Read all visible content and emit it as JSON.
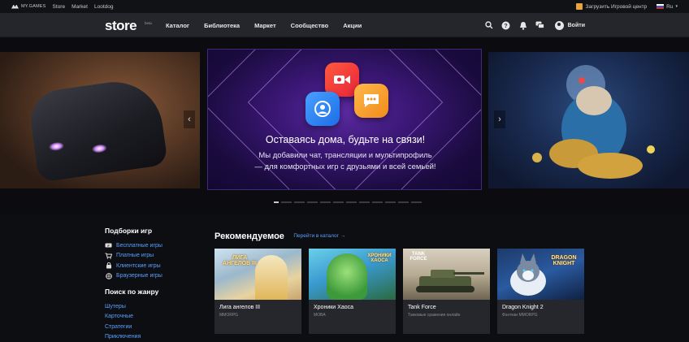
{
  "topbar": {
    "brand": "MY.GAMES",
    "links": [
      "Store",
      "Market",
      "Lootdog"
    ],
    "download_label": "Загрузить Игровой центр",
    "lang_label": "Ru"
  },
  "nav": {
    "logo": "store",
    "beta": "beta",
    "links": [
      "Каталог",
      "Библиотека",
      "Маркет",
      "Сообщество",
      "Акции"
    ],
    "login_label": "Войти"
  },
  "hero": {
    "title": "Оставаясь дома, будьте на связи!",
    "subtitle_line1": "Мы добавили чат, трансляции и мультипрофиль",
    "subtitle_line2": "— для комфортных игр с друзьями и всей семьей!",
    "slides_total": 12,
    "active_slide": 1
  },
  "sidebar": {
    "collections_title": "Подборки игр",
    "collections": [
      {
        "label": "Бесплатные игры",
        "icon": "free-icon"
      },
      {
        "label": "Платные игры",
        "icon": "cart-icon"
      },
      {
        "label": "Клиентские игры",
        "icon": "client-icon"
      },
      {
        "label": "Браузерные игры",
        "icon": "browser-icon"
      }
    ],
    "genre_title": "Поиск по жанру",
    "genres": [
      "Шутеры",
      "Карточные",
      "Стратегии",
      "Приключения"
    ]
  },
  "recommended": {
    "title": "Рекомендуемое",
    "catalog_link": "Перейти в каталог",
    "games": [
      {
        "name": "Лига ангелов III",
        "genre": "MMORPG",
        "logo": "ЛИГА АНГЕЛОВ III"
      },
      {
        "name": "Хроники Хаоса",
        "genre": "MOBA",
        "logo": "ХРОНИКИ ХАОСА"
      },
      {
        "name": "Tank Force",
        "genre": "Танковые сражения онлайн",
        "logo": "TANK FORCE"
      },
      {
        "name": "Dragon Knight 2",
        "genre": "Фэнтези MMORPG",
        "logo": "DRAGON KNIGHT"
      }
    ]
  },
  "colors": {
    "accent_link": "#5aa0ff",
    "nav_bg": "#25262b",
    "page_bg": "#0d0e12",
    "card_bg": "#26272c"
  }
}
